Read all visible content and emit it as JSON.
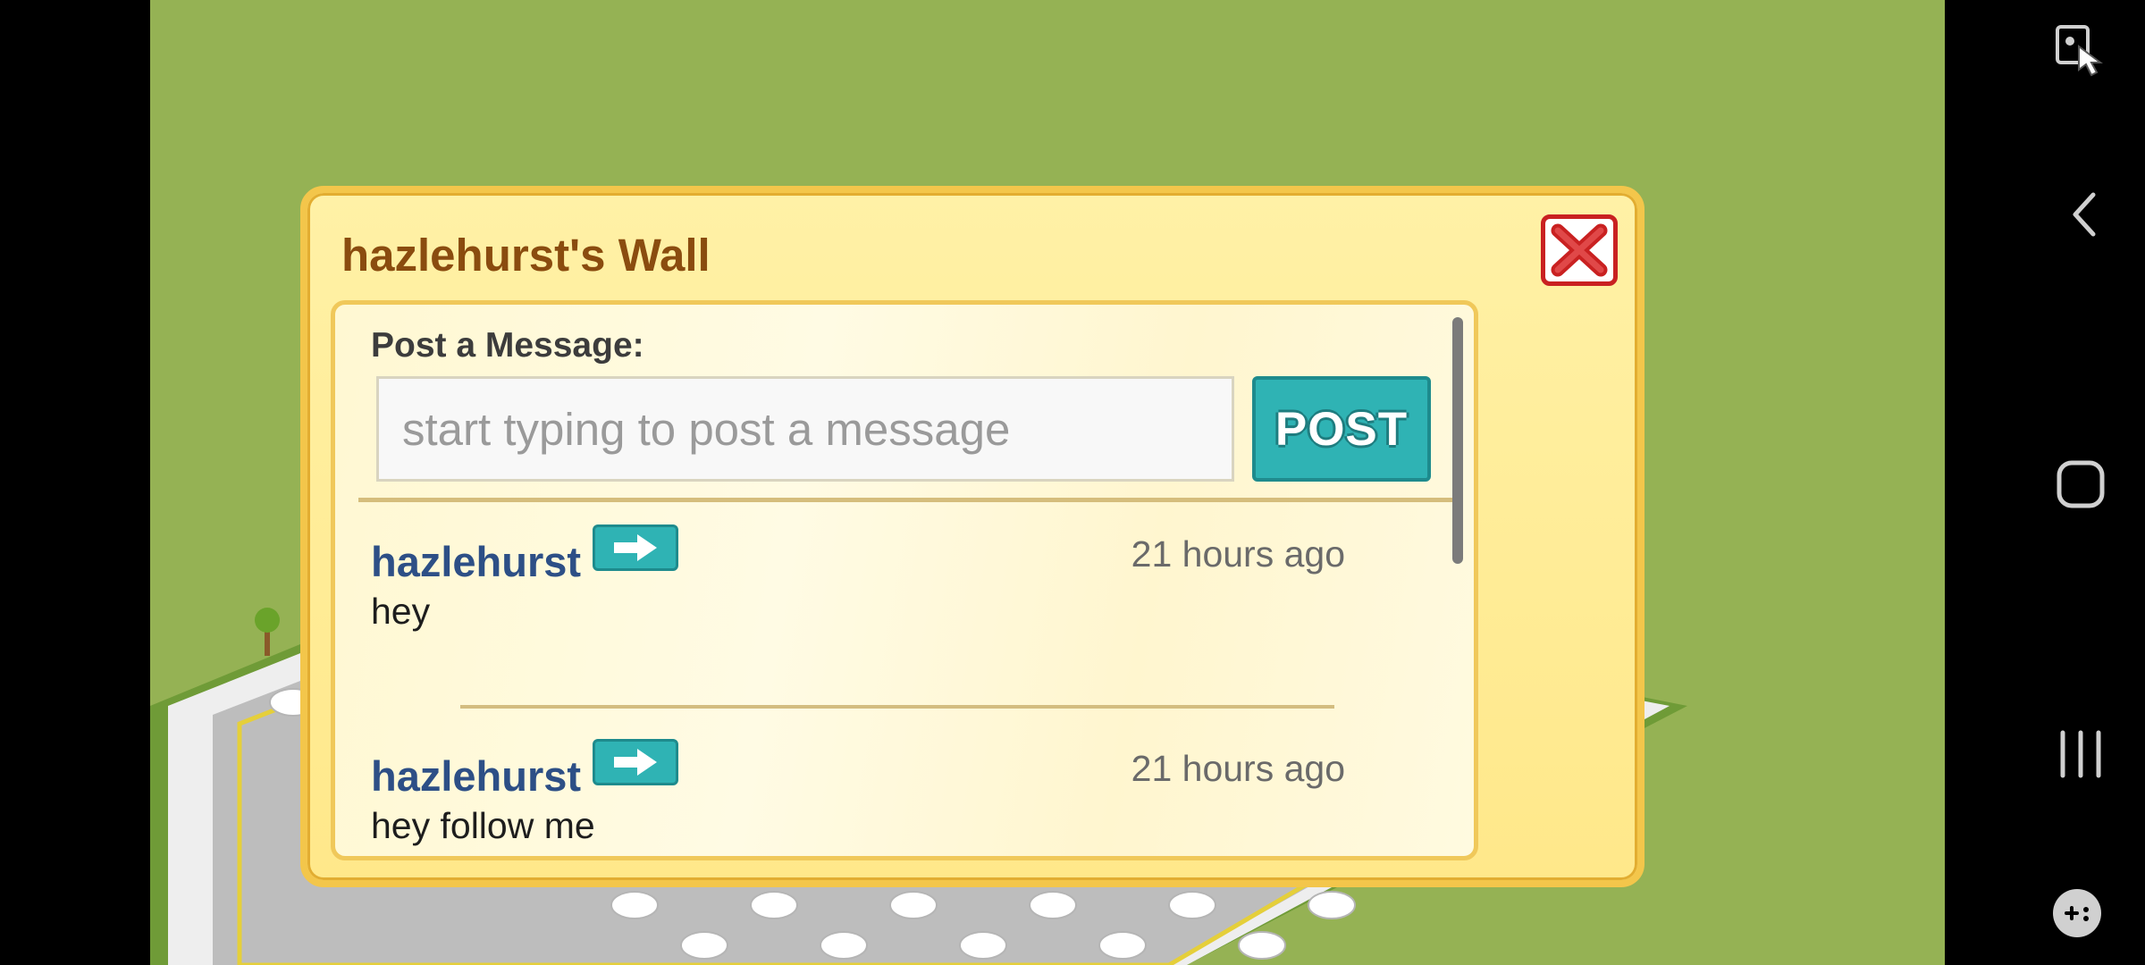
{
  "dialog": {
    "title": "hazlehurst's Wall",
    "post_label": "Post a Message:",
    "input_placeholder": "start typing to post a message",
    "input_value": "",
    "post_button": "POST"
  },
  "messages": [
    {
      "author": "hazlehurst",
      "time": "21 hours ago",
      "text": "hey"
    },
    {
      "author": "hazlehurst",
      "time": "21 hours ago",
      "text": "hey follow me"
    }
  ],
  "icons": {
    "close": "close-x-icon",
    "go": "arrow-right-icon",
    "nav": [
      "screen-assist-icon",
      "back-icon",
      "home-icon",
      "recents-icon",
      "game-launcher-icon"
    ]
  },
  "colors": {
    "background_grass": "#95b254",
    "dialog_bg": "#fff1a6",
    "dialog_border": "#f3c64b",
    "title_text": "#8a4c0f",
    "author_text": "#2d4f86",
    "teal_button": "#2fb3b4",
    "close_red": "#c92121"
  }
}
